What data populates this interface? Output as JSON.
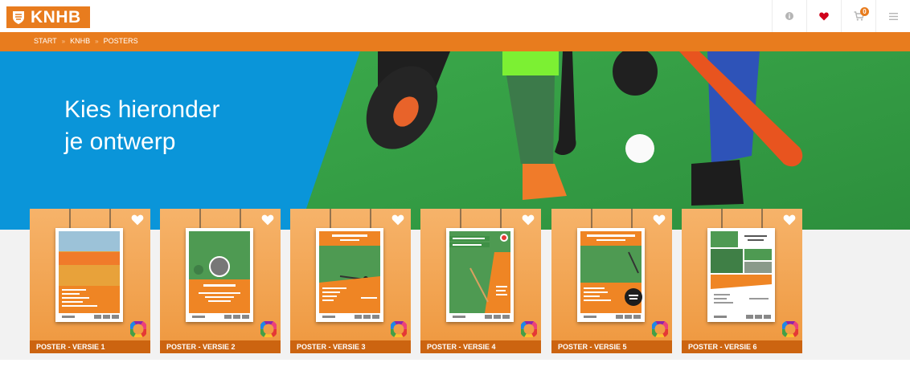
{
  "brand": {
    "name": "KNHB",
    "color": "#e87c1e"
  },
  "header_actions": [
    {
      "icon": "info-icon"
    },
    {
      "icon": "heart-icon",
      "color": "#d0021b"
    },
    {
      "icon": "cart-icon",
      "badge": "0"
    },
    {
      "icon": "menu-icon"
    }
  ],
  "breadcrumb": [
    "START",
    "KNHB",
    "POSTERS"
  ],
  "hero": {
    "line1": "Kies hieronder",
    "line2": "je ontwerp",
    "blue": "#0a95d9"
  },
  "posters": [
    {
      "label": "POSTER - VERSIE 1"
    },
    {
      "label": "POSTER - VERSIE 2"
    },
    {
      "label": "POSTER - VERSIE 3"
    },
    {
      "label": "POSTER - VERSIE 4"
    },
    {
      "label": "POSTER - VERSIE 5"
    },
    {
      "label": "POSTER - VERSIE 6"
    }
  ]
}
